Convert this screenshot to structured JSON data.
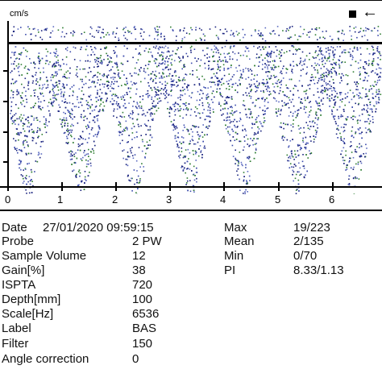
{
  "spectrum": {
    "velocity_unit": "cm/s",
    "x_ticks": [
      "0",
      "1",
      "2",
      "3",
      "4",
      "5",
      "6"
    ],
    "colors": {
      "baseline": "#000000",
      "signal_dark": "#1a237e",
      "signal_mid": "#3949ab",
      "signal_light": "#5c6bc0",
      "signal_green": "#2e7d32",
      "background": "#ffffff"
    }
  },
  "icons": {
    "stop": "stop-icon",
    "back": "back-arrow-icon"
  },
  "controls": {
    "back_arrow": "←"
  },
  "info": {
    "date_label": "Date",
    "date_value": "27/01/2020 09:59:15",
    "left": [
      {
        "label": "Probe",
        "value": "2 PW"
      },
      {
        "label": "Sample Volume",
        "value": "12"
      },
      {
        "label": "Gain[%]",
        "value": "38"
      },
      {
        "label": "ISPTA",
        "value": "720"
      },
      {
        "label": "Depth[mm]",
        "value": "100"
      },
      {
        "label": "Scale[Hz]",
        "value": "6536"
      },
      {
        "label": "Label",
        "value": "BAS"
      },
      {
        "label": "Filter",
        "value": "150"
      },
      {
        "label": "Angle correction",
        "value": "0"
      }
    ],
    "right": [
      {
        "label": "Max",
        "value": "19/223"
      },
      {
        "label": "Mean",
        "value": "2/135"
      },
      {
        "label": "Min",
        "value": "0/70"
      },
      {
        "label": "PI",
        "value": "8.33/1.13"
      }
    ]
  }
}
